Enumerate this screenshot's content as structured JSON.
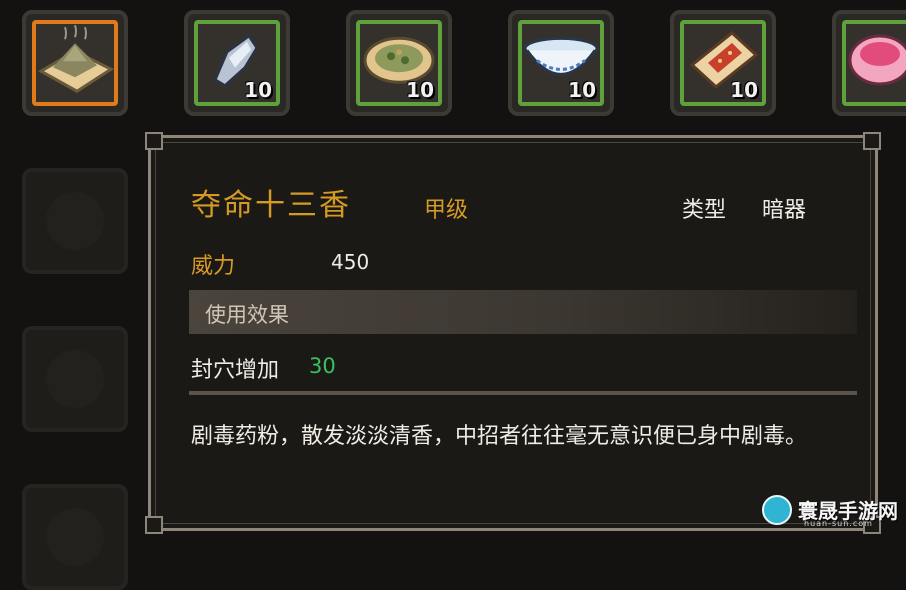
{
  "inventory": {
    "items": [
      {
        "name": "powder-pile",
        "qty": "",
        "selected": true
      },
      {
        "name": "dart",
        "qty": "10",
        "selected": false
      },
      {
        "name": "herb-plate",
        "qty": "10",
        "selected": false
      },
      {
        "name": "porcelain-bowl",
        "qty": "10",
        "selected": false
      },
      {
        "name": "red-book",
        "qty": "10",
        "selected": false
      },
      {
        "name": "pink-bowl",
        "qty": "",
        "selected": false
      }
    ]
  },
  "tooltip": {
    "item_name": "夺命十三香",
    "grade": "甲级",
    "type_label": "类型",
    "type_value": "暗器",
    "power_label": "威力",
    "power_value": "450",
    "effect_header": "使用效果",
    "effect_name": "封穴增加",
    "effect_value": "30",
    "description": "剧毒药粉，散发淡淡清香，中招者往往毫无意识便已身中剧毒。"
  },
  "watermark": {
    "name": "寰晟手游网",
    "url": "huan-sun.com"
  },
  "colors": {
    "gold": "#d59a24",
    "green_value": "#37c25e",
    "selected_border": "#e07a1a",
    "slot_border": "#5fa23c"
  }
}
